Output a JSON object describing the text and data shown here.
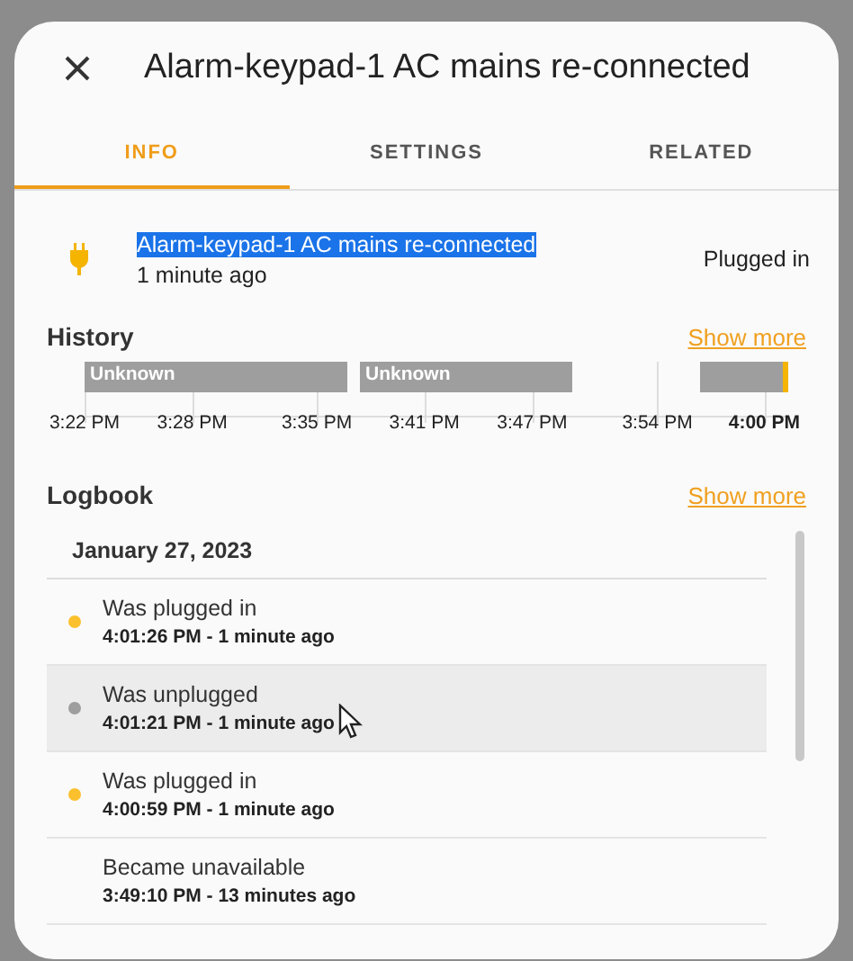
{
  "dialog": {
    "title": "Alarm-keypad-1 AC mains re-connected",
    "tabs": [
      {
        "label": "INFO",
        "selected": true
      },
      {
        "label": "SETTINGS",
        "selected": false
      },
      {
        "label": "RELATED",
        "selected": false
      }
    ],
    "entity": {
      "name": "Alarm-keypad-1 AC mains re-connected",
      "highlighted": true,
      "time": "1 minute ago",
      "state": "Plugged in"
    },
    "history": {
      "title": "History",
      "link": "Show more",
      "segments": [
        {
          "kind": "unknown",
          "label": "Unknown"
        },
        {
          "kind": "gap"
        },
        {
          "kind": "unknown",
          "label": "Unknown"
        },
        {
          "kind": "gap"
        },
        {
          "kind": "off"
        },
        {
          "kind": "on"
        }
      ],
      "ticks": [
        {
          "label": "3:22 PM",
          "current": false
        },
        {
          "label": "3:28 PM",
          "current": false
        },
        {
          "label": "3:35 PM",
          "current": false
        },
        {
          "label": "3:41 PM",
          "current": false
        },
        {
          "label": "3:47 PM",
          "current": false
        },
        {
          "label": "3:54 PM",
          "current": false
        },
        {
          "label": "4:00 PM",
          "current": true
        }
      ]
    },
    "logbook": {
      "title": "Logbook",
      "link": "Show more",
      "date": "January 27, 2023",
      "entries": [
        {
          "message": "Was plugged in",
          "time": "4:01:26 PM - 1 minute ago",
          "color": "#fbc02d",
          "hovered": false
        },
        {
          "message": "Was unplugged",
          "time": "4:01:21 PM - 1 minute ago",
          "color": "#9e9e9e",
          "hovered": true
        },
        {
          "message": "Was plugged in",
          "time": "4:00:59 PM - 1 minute ago",
          "color": "#fbc02d",
          "hovered": false
        },
        {
          "message": "Became unavailable",
          "time": "3:49:10 PM - 13 minutes ago",
          "hovered": false
        }
      ]
    }
  }
}
